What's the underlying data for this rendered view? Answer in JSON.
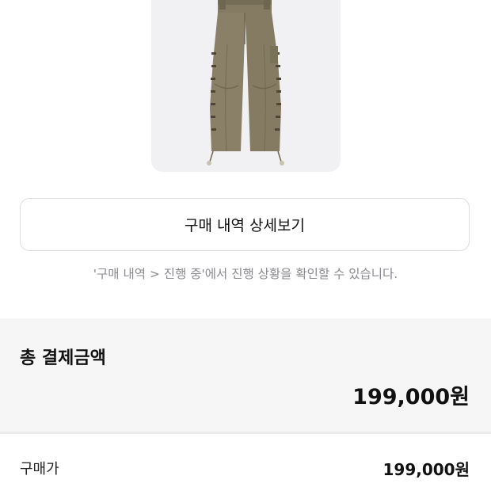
{
  "product": {
    "image_description_icon": "cargo-pants-image",
    "color": "#8a8067"
  },
  "detail_button": {
    "label": "구매 내역 상세보기"
  },
  "hint_text": "'구매 내역 > 진행 중'에서 진행 상황을 확인할 수 있습니다.",
  "total": {
    "title": "총 결제금액",
    "amount": "199,000원"
  },
  "breakdown": {
    "purchase_price_label": "구매가",
    "purchase_price_value": "199,000원"
  },
  "colors": {
    "section_bg": "#f6f6f6",
    "hint_text": "#8a8a8f",
    "button_border": "#dddde0"
  }
}
